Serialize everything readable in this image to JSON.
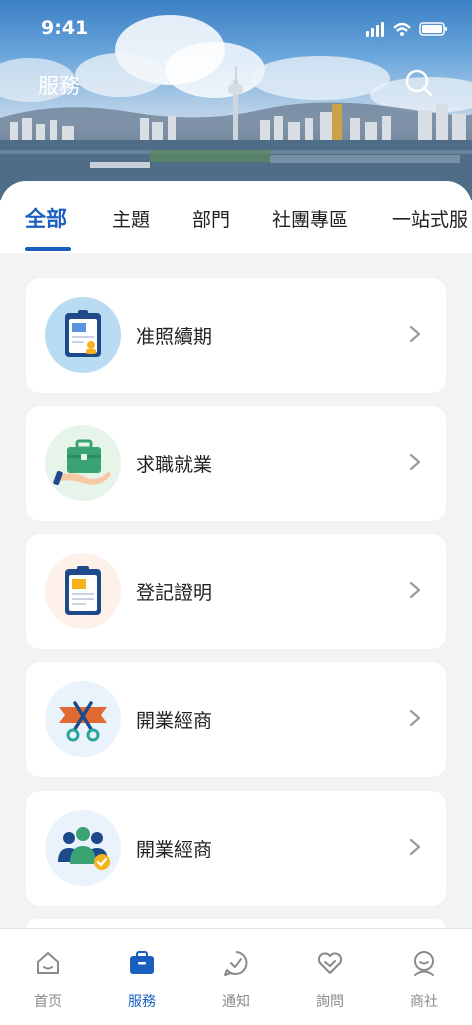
{
  "status_bar": {
    "time": "9:41"
  },
  "header": {
    "title": "服務"
  },
  "tabs": [
    {
      "label": "全部",
      "active": true
    },
    {
      "label": "主題"
    },
    {
      "label": "部門"
    },
    {
      "label": "社團專區"
    },
    {
      "label": "一站式服"
    }
  ],
  "services": [
    {
      "label": "准照續期",
      "icon": "license-card-icon"
    },
    {
      "label": "求職就業",
      "icon": "briefcase-hand-icon"
    },
    {
      "label": "登記證明",
      "icon": "clipboard-document-icon"
    },
    {
      "label": "開業經商",
      "icon": "ribbon-scissors-icon"
    },
    {
      "label": "開業經商",
      "icon": "team-check-icon"
    }
  ],
  "bottom_nav": [
    {
      "label": "首页",
      "icon": "home-icon"
    },
    {
      "label": "服務",
      "icon": "briefcase-icon",
      "active": true
    },
    {
      "label": "通知",
      "icon": "chat-check-icon"
    },
    {
      "label": "詢問",
      "icon": "heart-handshake-icon"
    },
    {
      "label": "商社",
      "icon": "user-icon"
    }
  ],
  "colors": {
    "accent": "#1a5fc0",
    "background": "#f2f3f5"
  }
}
